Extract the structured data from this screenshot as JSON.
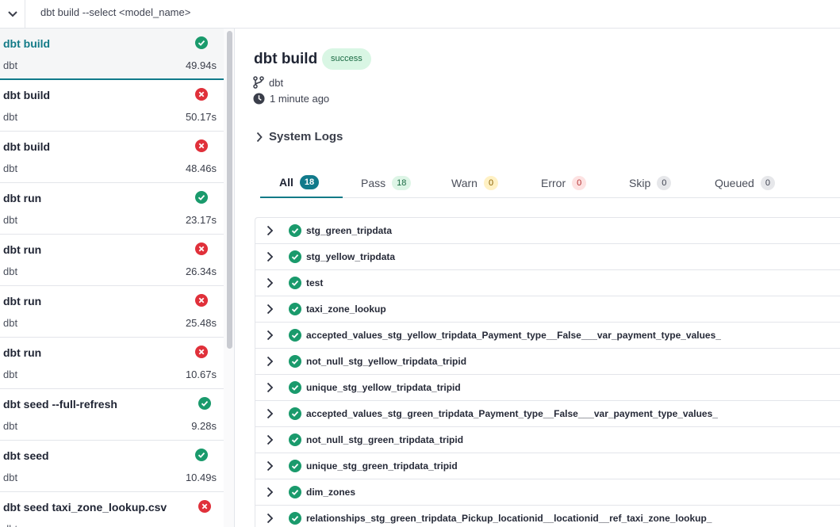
{
  "topbar": {
    "command": "dbt build --select <model_name>"
  },
  "sidebar": {
    "runs": [
      {
        "name": "dbt build",
        "project": "dbt",
        "duration": "49.94s",
        "status": "success"
      },
      {
        "name": "dbt build",
        "project": "dbt",
        "duration": "50.17s",
        "status": "error"
      },
      {
        "name": "dbt build",
        "project": "dbt",
        "duration": "48.46s",
        "status": "error"
      },
      {
        "name": "dbt run",
        "project": "dbt",
        "duration": "23.17s",
        "status": "success"
      },
      {
        "name": "dbt run",
        "project": "dbt",
        "duration": "26.34s",
        "status": "error"
      },
      {
        "name": "dbt run",
        "project": "dbt",
        "duration": "25.48s",
        "status": "error"
      },
      {
        "name": "dbt run",
        "project": "dbt",
        "duration": "10.67s",
        "status": "error"
      },
      {
        "name": "dbt seed --full-refresh",
        "project": "dbt",
        "duration": "9.28s",
        "status": "success"
      },
      {
        "name": "dbt seed",
        "project": "dbt",
        "duration": "10.49s",
        "status": "success"
      },
      {
        "name": "dbt seed taxi_zone_lookup.csv",
        "project": "dbt",
        "duration": "",
        "status": "error"
      }
    ]
  },
  "detail": {
    "title": "dbt build",
    "status_badge": "success",
    "project": "dbt",
    "time_ago": "1 minute ago",
    "system_logs_label": "System Logs",
    "tabs": [
      {
        "label": "All",
        "count": "18",
        "kind": "all"
      },
      {
        "label": "Pass",
        "count": "18",
        "kind": "pass"
      },
      {
        "label": "Warn",
        "count": "0",
        "kind": "warn"
      },
      {
        "label": "Error",
        "count": "0",
        "kind": "error"
      },
      {
        "label": "Skip",
        "count": "0",
        "kind": "neutral"
      },
      {
        "label": "Queued",
        "count": "0",
        "kind": "neutral"
      }
    ],
    "results": [
      "stg_green_tripdata",
      "stg_yellow_tripdata",
      "test",
      "taxi_zone_lookup",
      "accepted_values_stg_yellow_tripdata_Payment_type__False___var_payment_type_values_",
      "not_null_stg_yellow_tripdata_tripid",
      "unique_stg_yellow_tripdata_tripid",
      "accepted_values_stg_green_tripdata_Payment_type__False___var_payment_type_values_",
      "not_null_stg_green_tripdata_tripid",
      "unique_stg_green_tripdata_tripid",
      "dim_zones",
      "relationships_stg_green_tripdata_Pickup_locationid__locationid__ref_taxi_zone_lookup_"
    ]
  },
  "colors": {
    "accent": "#127a87",
    "success": "#1a9a6c",
    "error": "#e0303a"
  }
}
